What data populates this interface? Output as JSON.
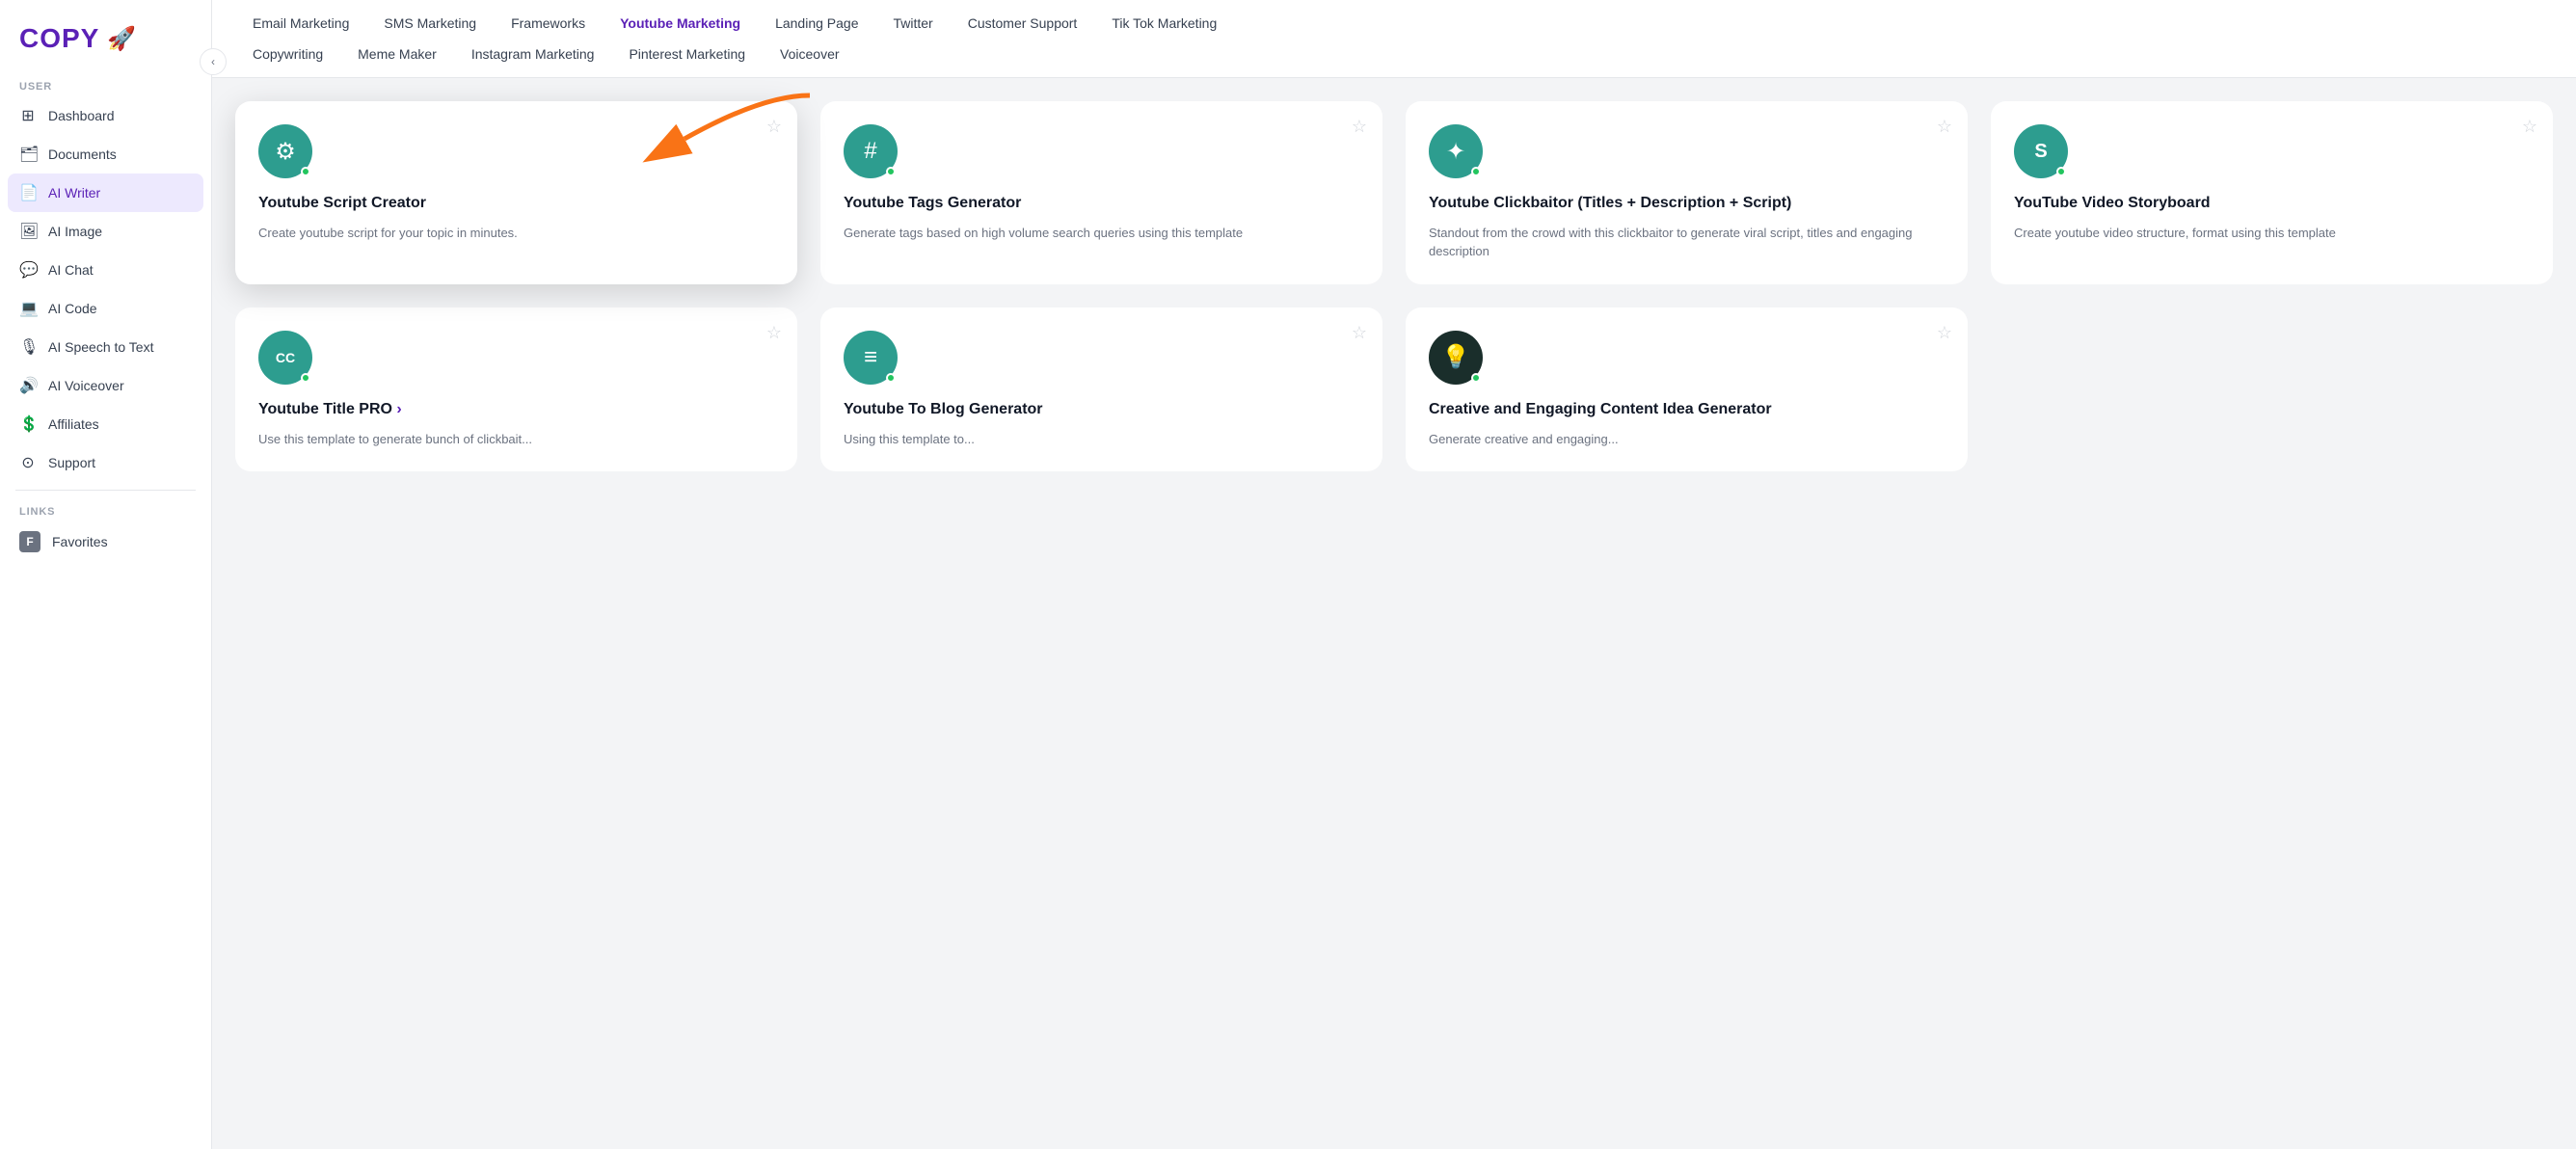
{
  "app": {
    "logo": "COPY",
    "logo_icon": "🚀"
  },
  "sidebar": {
    "section_user": "USER",
    "section_links": "LINKS",
    "items": [
      {
        "id": "dashboard",
        "label": "Dashboard",
        "icon": "⊞"
      },
      {
        "id": "documents",
        "label": "Documents",
        "icon": "🗂"
      },
      {
        "id": "ai-writer",
        "label": "AI Writer",
        "icon": "📄",
        "active": true
      },
      {
        "id": "ai-image",
        "label": "AI Image",
        "icon": "🖼"
      },
      {
        "id": "ai-chat",
        "label": "AI Chat",
        "icon": "💬"
      },
      {
        "id": "ai-code",
        "label": "AI Code",
        "icon": "💻"
      },
      {
        "id": "ai-speech",
        "label": "AI Speech to Text",
        "icon": "🎙"
      },
      {
        "id": "ai-voiceover",
        "label": "AI Voiceover",
        "icon": "🔊"
      },
      {
        "id": "affiliates",
        "label": "Affiliates",
        "icon": "💲"
      },
      {
        "id": "support",
        "label": "Support",
        "icon": "⊙"
      }
    ],
    "links": [
      {
        "id": "favorites",
        "label": "Favorites",
        "icon": "F"
      }
    ]
  },
  "nav": {
    "row1": [
      {
        "id": "email-marketing",
        "label": "Email Marketing"
      },
      {
        "id": "sms-marketing",
        "label": "SMS Marketing"
      },
      {
        "id": "frameworks",
        "label": "Frameworks"
      },
      {
        "id": "youtube-marketing",
        "label": "Youtube Marketing",
        "active": true
      },
      {
        "id": "landing-page",
        "label": "Landing Page"
      },
      {
        "id": "twitter",
        "label": "Twitter"
      },
      {
        "id": "customer-support",
        "label": "Customer Support"
      },
      {
        "id": "tiktok",
        "label": "Tik Tok Marketing"
      }
    ],
    "row2": [
      {
        "id": "copywriting",
        "label": "Copywriting"
      },
      {
        "id": "meme-maker",
        "label": "Meme Maker"
      },
      {
        "id": "instagram",
        "label": "Instagram Marketing"
      },
      {
        "id": "pinterest",
        "label": "Pinterest Marketing"
      },
      {
        "id": "voiceover",
        "label": "Voiceover"
      }
    ]
  },
  "cards_row1": [
    {
      "id": "youtube-script",
      "title": "Youtube Script Creator",
      "desc": "Create youtube script for your topic in minutes.",
      "icon": "⚙",
      "highlighted": true
    },
    {
      "id": "youtube-tags",
      "title": "Youtube Tags Generator",
      "desc": "Generate tags based on high volume search queries using this template",
      "icon": "#",
      "highlighted": false
    },
    {
      "id": "youtube-clickbaitor",
      "title": "Youtube Clickbaitor (Titles + Description + Script)",
      "desc": "Standout from the crowd with this clickbaitor to generate viral script, titles and engaging description",
      "icon": "✦",
      "highlighted": false
    },
    {
      "id": "youtube-storyboard",
      "title": "YouTube Video Storyboard",
      "desc": "Create youtube video structure, format using this template",
      "icon": "S",
      "highlighted": false
    }
  ],
  "cards_row2": [
    {
      "id": "youtube-title-pro",
      "title": "Youtube Title PRO",
      "desc": "Use this template to generate bunch of clickbait...",
      "icon": "CC",
      "has_arrow": true
    },
    {
      "id": "youtube-to-blog",
      "title": "Youtube To Blog Generator",
      "desc": "Using this template to...",
      "icon": "≡",
      "has_arrow": false
    },
    {
      "id": "creative-content",
      "title": "Creative and Engaging Content Idea Generator",
      "desc": "Generate creative and engaging...",
      "icon": "💡",
      "dark": true,
      "has_arrow": false
    }
  ]
}
